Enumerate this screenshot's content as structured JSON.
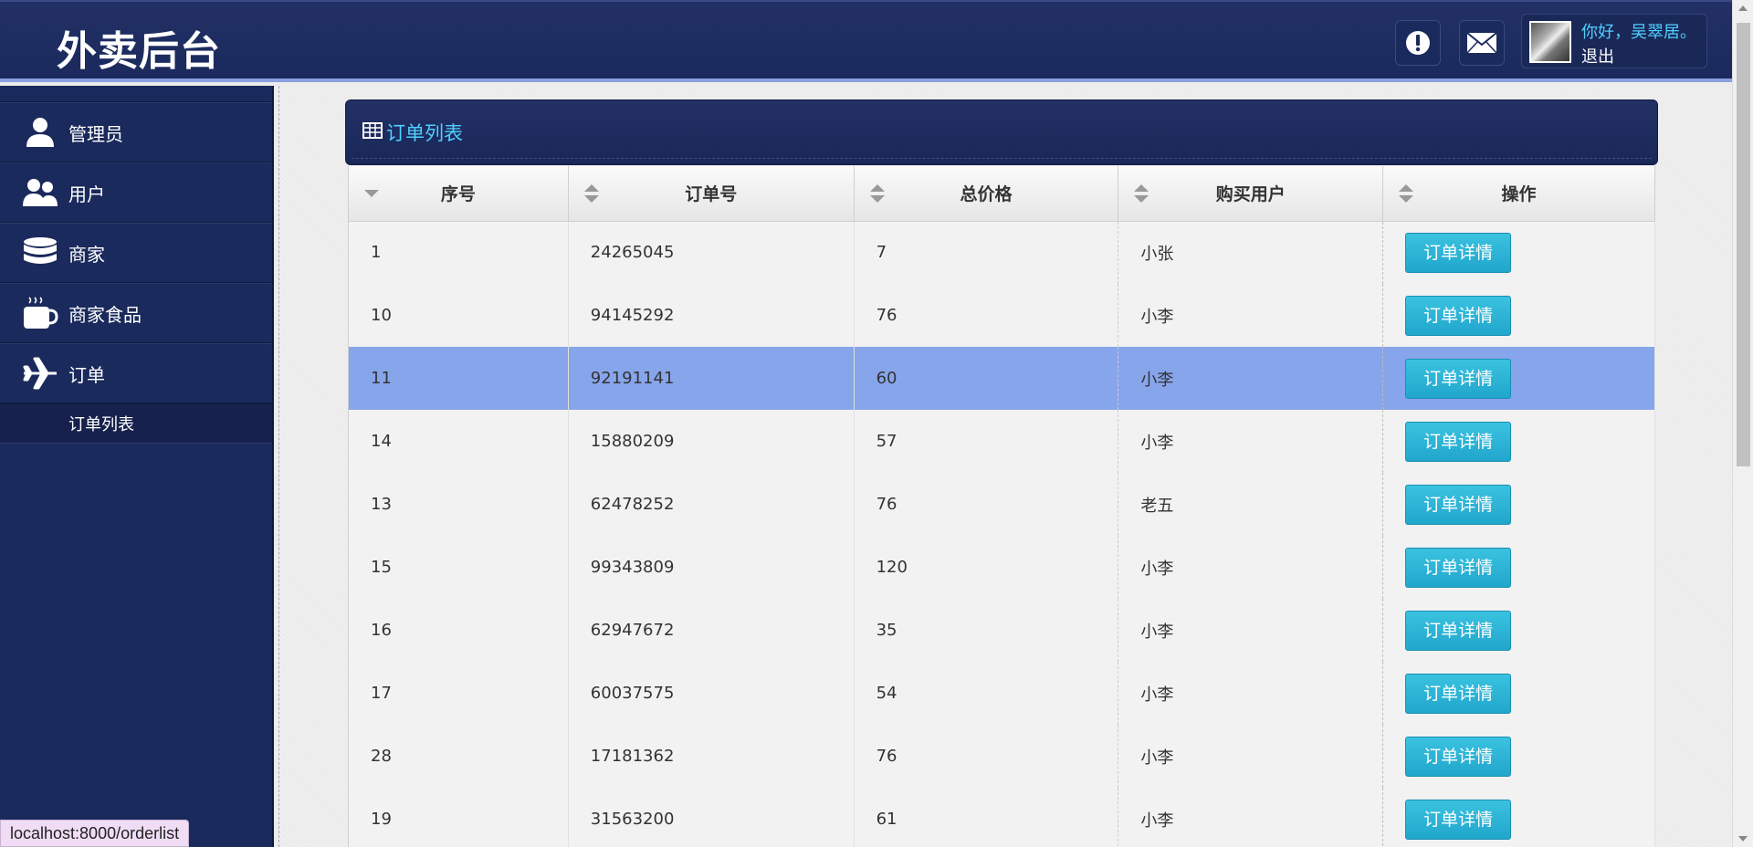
{
  "header": {
    "brand": "外卖后台",
    "greeting": "你好，吴翠居。",
    "logout": "退出",
    "icons": [
      "alert-icon",
      "mail-icon"
    ]
  },
  "sidebar": {
    "items": [
      {
        "label": "管理员",
        "icon": "admin-user-icon"
      },
      {
        "label": "用户",
        "icon": "users-icon"
      },
      {
        "label": "商家",
        "icon": "database-icon"
      },
      {
        "label": "商家食品",
        "icon": "coffee-cup-icon"
      },
      {
        "label": "订单",
        "icon": "airplane-icon"
      }
    ],
    "sub_items": [
      {
        "label": "订单列表"
      }
    ]
  },
  "panel": {
    "title": "订单列表"
  },
  "table": {
    "headers": [
      "序号",
      "订单号",
      "总价格",
      "购买用户",
      "操作"
    ],
    "rows": [
      {
        "id": "1",
        "order_no": "24265045",
        "total": "7",
        "user": "小张",
        "action": "订单详情"
      },
      {
        "id": "10",
        "order_no": "94145292",
        "total": "76",
        "user": "小李",
        "action": "订单详情"
      },
      {
        "id": "11",
        "order_no": "92191141",
        "total": "60",
        "user": "小李",
        "action": "订单详情"
      },
      {
        "id": "14",
        "order_no": "15880209",
        "total": "57",
        "user": "小李",
        "action": "订单详情"
      },
      {
        "id": "13",
        "order_no": "62478252",
        "total": "76",
        "user": "老五",
        "action": "订单详情"
      },
      {
        "id": "15",
        "order_no": "99343809",
        "total": "120",
        "user": "小李",
        "action": "订单详情"
      },
      {
        "id": "16",
        "order_no": "62947672",
        "total": "35",
        "user": "小李",
        "action": "订单详情"
      },
      {
        "id": "17",
        "order_no": "60037575",
        "total": "54",
        "user": "小李",
        "action": "订单详情"
      },
      {
        "id": "28",
        "order_no": "17181362",
        "total": "76",
        "user": "小李",
        "action": "订单详情"
      },
      {
        "id": "19",
        "order_no": "31563200",
        "total": "61",
        "user": "小李",
        "action": "订单详情"
      }
    ],
    "selected_row_index": 2
  },
  "statusbar": {
    "url": "localhost:8000/orderlist"
  },
  "colors": {
    "header_bg": "#1b2a5c",
    "accent_cyan": "#4fd0ff",
    "button_bg": "#2bb3d6",
    "selected_row": "#87a5eb"
  }
}
